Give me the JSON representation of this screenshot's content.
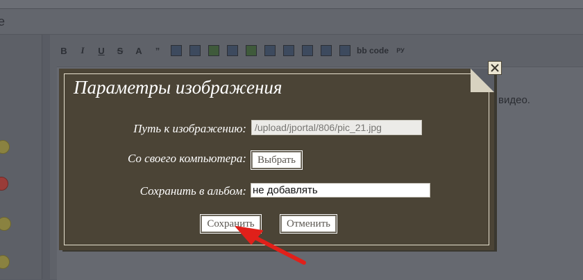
{
  "background": {
    "title_fragment": "e",
    "toolbar": {
      "bold": "B",
      "italic": "I",
      "underline": "U",
      "strike": "S",
      "font": "A",
      "quote": "”",
      "bbcode": "bb code",
      "translit": "РУ"
    },
    "editor_text": "видео."
  },
  "modal": {
    "title": "Параметры изображения",
    "path_label": "Путь к изображению:",
    "path_value": "/upload/jportal/806/pic_21.jpg",
    "computer_label": "Со своего компьютера:",
    "choose_button": "Выбрать",
    "album_label": "Сохранить в альбом:",
    "album_value": "не добавлять",
    "save_button": "Сохранить",
    "cancel_button": "Отменить"
  },
  "colors": {
    "modal_bg": "#4b4436",
    "annotation_arrow": "#e0201a"
  },
  "icons": {
    "close": "close-icon",
    "arrow": "red-arrow-annotation"
  }
}
